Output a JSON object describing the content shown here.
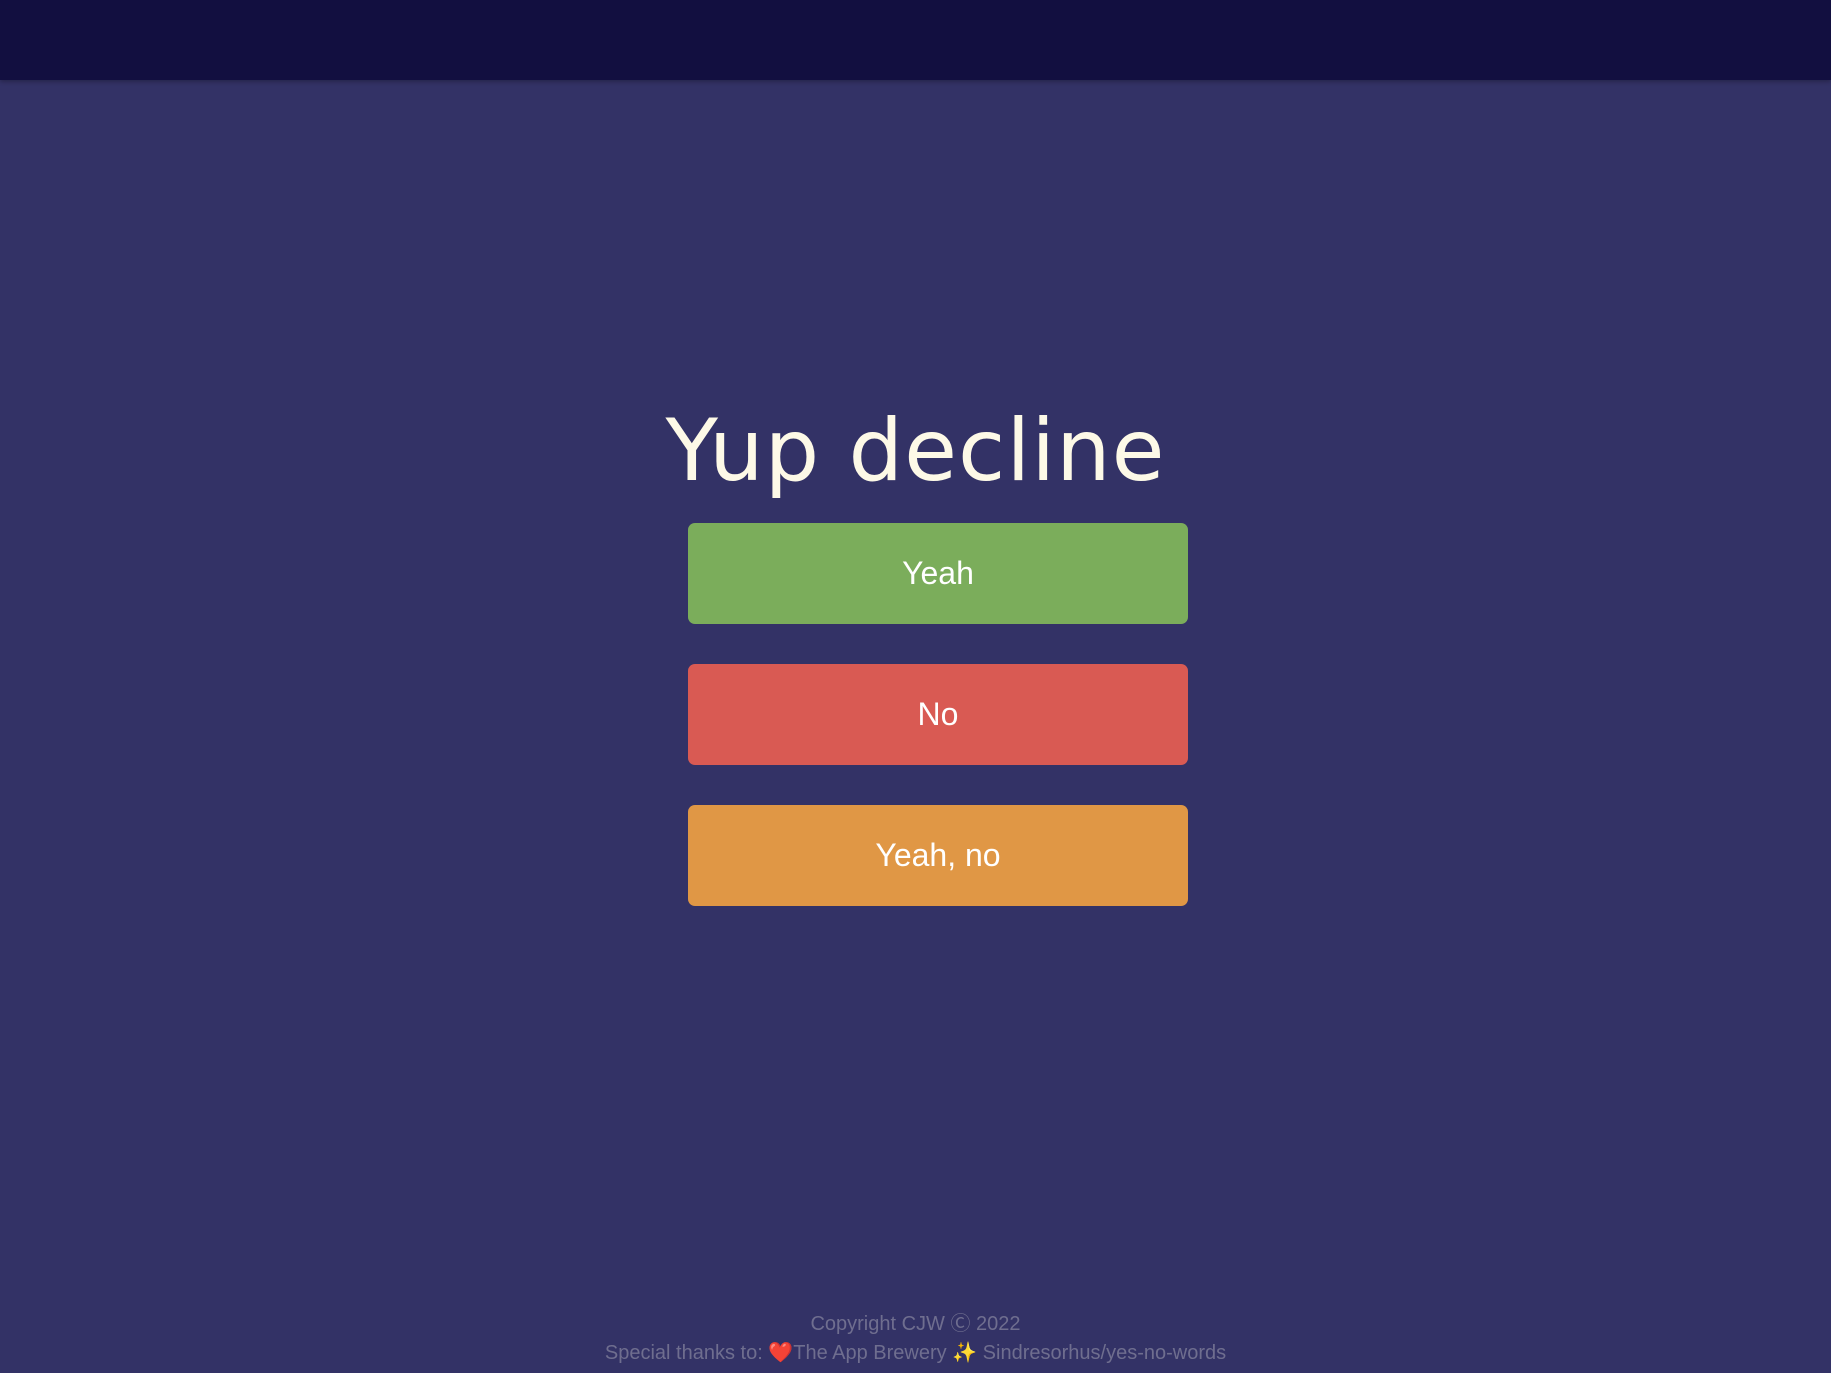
{
  "page": {
    "colors": {
      "background": "#333266",
      "topbar": "#120f40",
      "title": "#fdf9e7",
      "yeah_button": "#7bad5b",
      "no_button": "#d95a53",
      "yeah_no_button": "#e09745",
      "footer_text": "#6f6e8f"
    }
  },
  "title": "Yup decline",
  "buttons": {
    "yeah": "Yeah",
    "no": "No",
    "yeah_no": "Yeah, no"
  },
  "footer": {
    "copyright": "Copyright CJW Ⓒ 2022",
    "thanks_prefix": "Special thanks to: ",
    "heart_icon": "❤️",
    "credit_1": "The App Brewery ",
    "sparkle_icon": "✨",
    "credit_2": " Sindresorhus/yes-no-words"
  }
}
